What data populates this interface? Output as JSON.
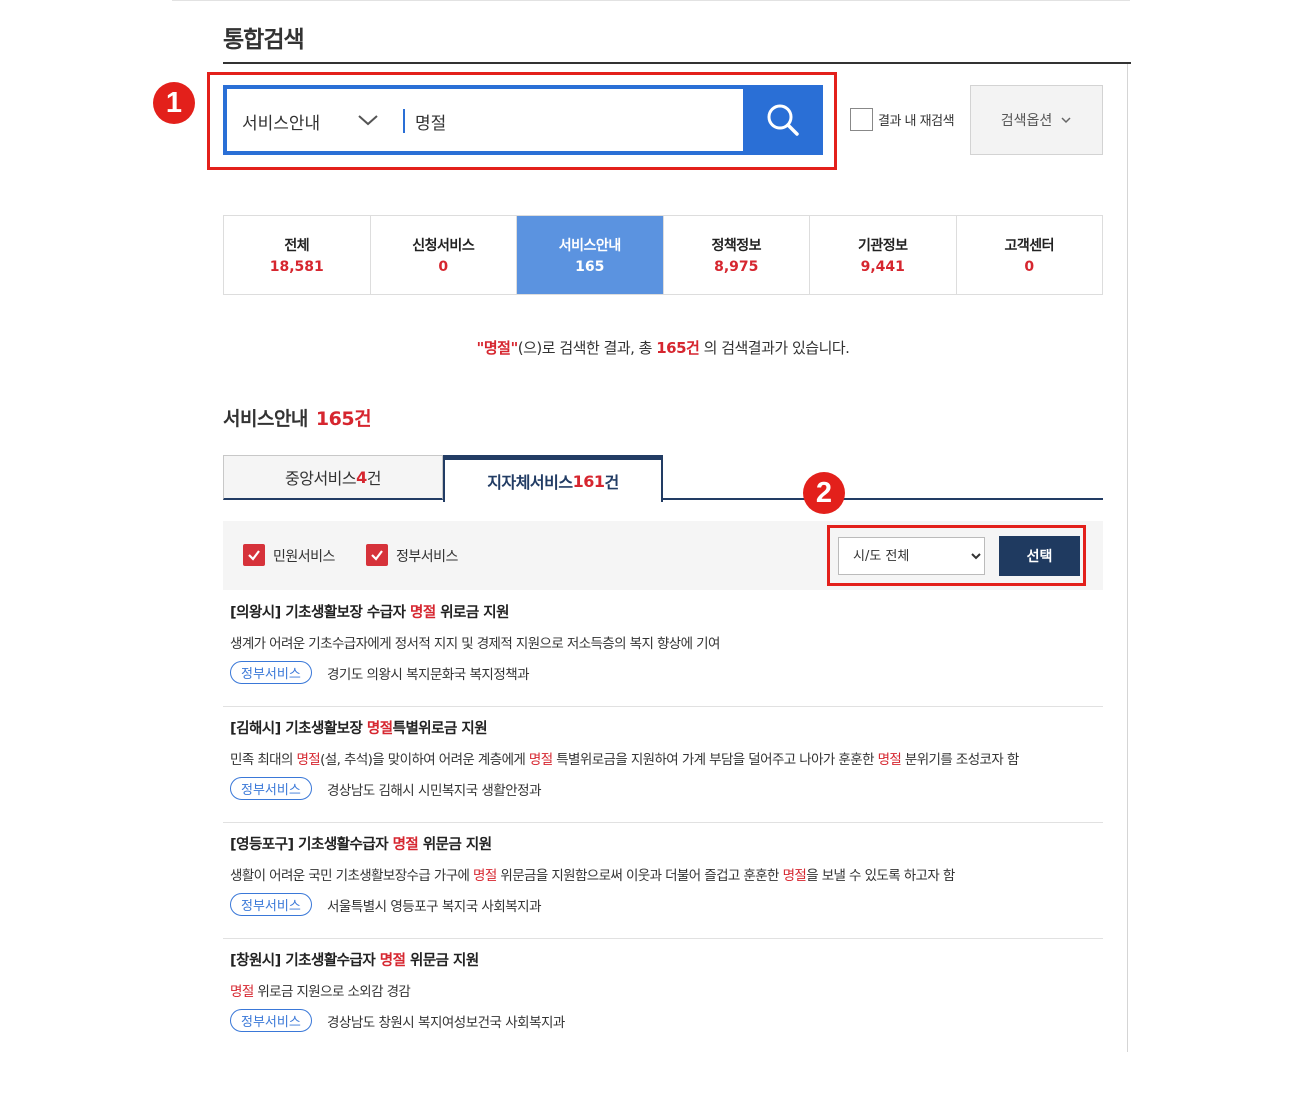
{
  "page_title": "통합검색",
  "callouts": [
    "1",
    "2"
  ],
  "search": {
    "category": "서비스안내",
    "query": "명절",
    "button_label": "검색",
    "within_results_label": "결과 내 재검색",
    "options_label": "검색옵션"
  },
  "category_tabs": [
    {
      "label": "전체",
      "count": "18,581"
    },
    {
      "label": "신청서비스",
      "count": "0"
    },
    {
      "label": "서비스안내",
      "count": "165"
    },
    {
      "label": "정책정보",
      "count": "8,975"
    },
    {
      "label": "기관정보",
      "count": "9,441"
    },
    {
      "label": "고객센터",
      "count": "0"
    }
  ],
  "summary": {
    "term": "\"명절\"",
    "mid": "(으)로 검색한 결과, 총 ",
    "total": "165건",
    "end": " 의 검색결과가 있습니다."
  },
  "section": {
    "title": "서비스안내",
    "count": "165건"
  },
  "sub_tabs": [
    {
      "label": "중앙서비스 ",
      "count": "4",
      "unit": "건"
    },
    {
      "label": "지자체서비스 ",
      "count": "161",
      "unit": "건"
    }
  ],
  "filters": {
    "checkboxes": [
      "민원서비스",
      "정부서비스"
    ],
    "region_select": "시/도 전체",
    "select_button": "선택"
  },
  "results": [
    {
      "title_parts": [
        "[의왕시] 기초생활보장 수급자 ",
        "명절",
        " 위로금 지원"
      ],
      "desc_parts": [
        "생계가 어려운 기초수급자에게 정서적 지지 및 경제적 지원으로 저소득층의 복지 향상에 기여"
      ],
      "badge": "정부서비스",
      "org": "경기도 의왕시 복지문화국 복지정책과"
    },
    {
      "title_parts": [
        "[김해시] 기초생활보장 ",
        "명절",
        "특별위로금 지원"
      ],
      "desc_parts": [
        "민족 최대의 ",
        "명절",
        "(설, 추석)을 맞이하여 어려운 계층에게 ",
        "명절",
        " 특별위로금을 지원하여 가계 부담을 덜어주고 나아가 훈훈한 ",
        "명절",
        " 분위기를 조성코자 함"
      ],
      "badge": "정부서비스",
      "org": "경상남도 김해시 시민복지국 생활안정과"
    },
    {
      "title_parts": [
        "[영등포구] 기초생활수급자 ",
        "명절",
        " 위문금 지원"
      ],
      "desc_parts": [
        "생활이 어려운 국민 기초생활보장수급 가구에 ",
        "명절",
        " 위문금을 지원함으로써 이웃과 더불어 즐겁고 훈훈한 ",
        "명절",
        "을 보낼 수 있도록 하고자 함"
      ],
      "badge": "정부서비스",
      "org": "서울특별시 영등포구 복지국 사회복지과"
    },
    {
      "title_parts": [
        "[창원시] 기초생활수급자 ",
        "명절",
        " 위문금 지원"
      ],
      "desc_parts": [
        "",
        "명절",
        " 위로금 지원으로 소외감 경감"
      ],
      "badge": "정부서비스",
      "org": "경상남도 창원시 복지여성보건국 사회복지과"
    }
  ]
}
